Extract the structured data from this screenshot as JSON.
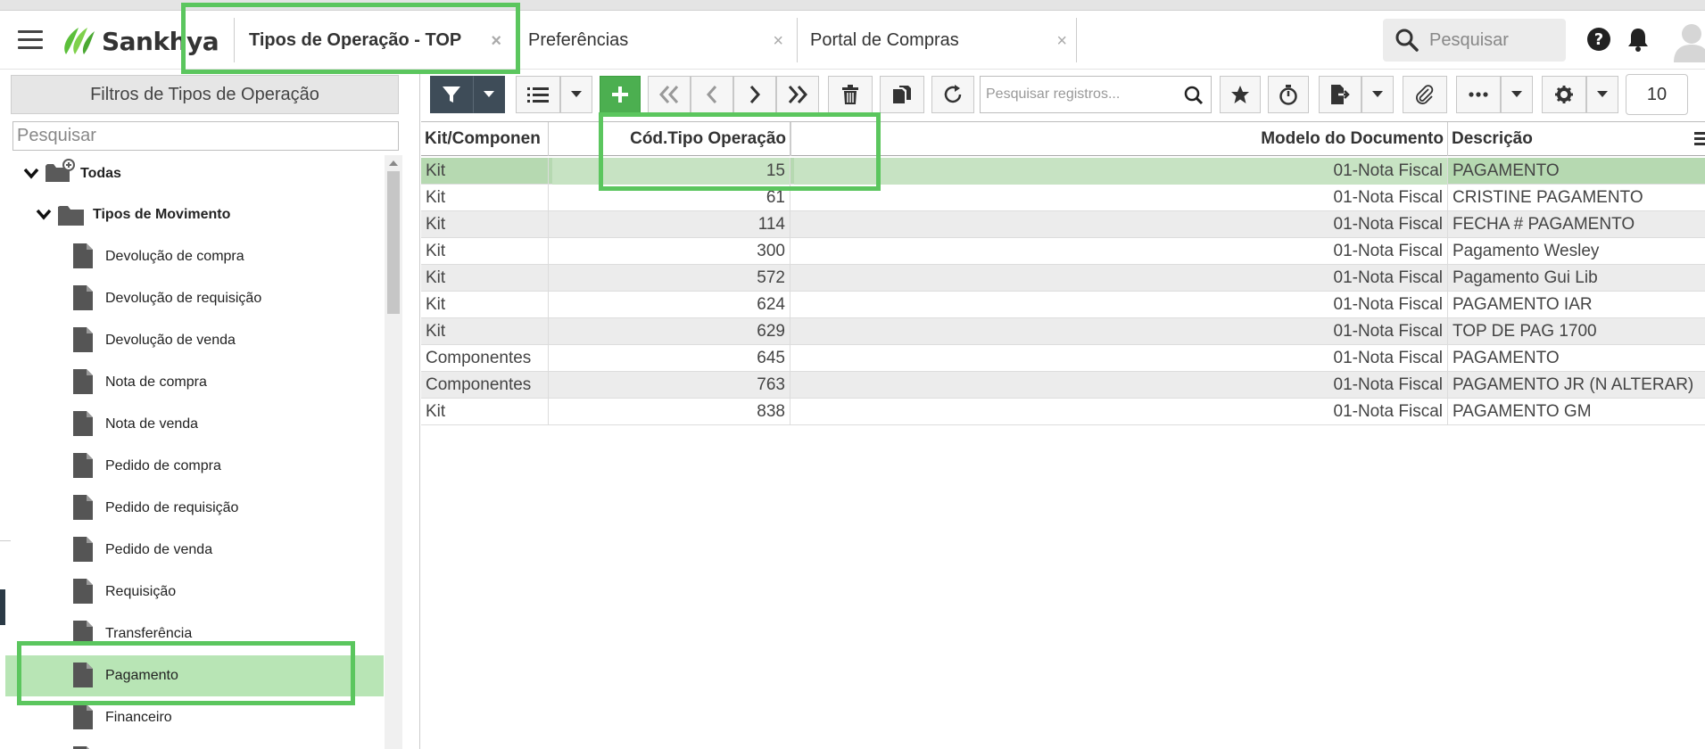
{
  "header": {
    "logo_text": "Sankhya",
    "tabs": [
      {
        "label": "Tipos de Operação - TOP",
        "active": true
      },
      {
        "label": "Preferências",
        "active": false
      },
      {
        "label": "Portal de Compras",
        "active": false
      }
    ],
    "close_glyph": "×",
    "search_placeholder": "Pesquisar",
    "icons": [
      "menu-icon",
      "search-icon",
      "help-icon",
      "bell-icon",
      "avatar-icon"
    ]
  },
  "sidebar": {
    "title": "Filtros de Tipos de Operação",
    "search_placeholder": "Pesquisar",
    "root": {
      "label": "Todas",
      "icon": "folder-plus-icon"
    },
    "group": {
      "label": "Tipos de Movimento",
      "icon": "folder-icon"
    },
    "items": [
      {
        "label": "Devolução de compra"
      },
      {
        "label": "Devolução de requisição"
      },
      {
        "label": "Devolução de venda"
      },
      {
        "label": "Nota de compra"
      },
      {
        "label": "Nota de venda"
      },
      {
        "label": "Pedido de compra"
      },
      {
        "label": "Pedido de requisição"
      },
      {
        "label": "Pedido de venda"
      },
      {
        "label": "Requisição"
      },
      {
        "label": "Transferência"
      },
      {
        "label": "Pagamento",
        "selected": true
      },
      {
        "label": "Financeiro"
      }
    ]
  },
  "toolbar": {
    "search_placeholder": "Pesquisar registros...",
    "page_size": "10",
    "buttons": [
      "filter-icon",
      "dropdown-icon",
      "list-icon",
      "dropdown-icon",
      "add-icon",
      "first-icon",
      "previous-icon",
      "next-icon",
      "last-icon",
      "delete-icon",
      "duplicate-icon",
      "refresh-icon",
      "star-icon",
      "timer-icon",
      "export-icon",
      "dropdown-icon",
      "attach-icon",
      "more-icon",
      "dropdown-icon",
      "gear-icon",
      "dropdown-icon"
    ]
  },
  "grid": {
    "columns": [
      "Kit/Componen",
      "Cód.Tipo Operação",
      "",
      "Modelo do Documento",
      "Descrição"
    ],
    "rows": [
      {
        "kit": "Kit",
        "codigo": "15",
        "modelo": "01-Nota Fiscal",
        "descricao": "PAGAMENTO",
        "selected": true
      },
      {
        "kit": "Kit",
        "codigo": "61",
        "modelo": "01-Nota Fiscal",
        "descricao": "CRISTINE PAGAMENTO"
      },
      {
        "kit": "Kit",
        "codigo": "114",
        "modelo": "01-Nota Fiscal",
        "descricao": "FECHA # PAGAMENTO"
      },
      {
        "kit": "Kit",
        "codigo": "300",
        "modelo": "01-Nota Fiscal",
        "descricao": "Pagamento Wesley"
      },
      {
        "kit": "Kit",
        "codigo": "572",
        "modelo": "01-Nota Fiscal",
        "descricao": "Pagamento Gui Lib"
      },
      {
        "kit": "Kit",
        "codigo": "624",
        "modelo": "01-Nota Fiscal",
        "descricao": "PAGAMENTO IAR"
      },
      {
        "kit": "Kit",
        "codigo": "629",
        "modelo": "01-Nota Fiscal",
        "descricao": "TOP DE PAG 1700"
      },
      {
        "kit": "Componentes",
        "codigo": "645",
        "modelo": "01-Nota Fiscal",
        "descricao": "PAGAMENTO"
      },
      {
        "kit": "Componentes",
        "codigo": "763",
        "modelo": "01-Nota Fiscal",
        "descricao": "PAGAMENTO JR (N ALTERAR)"
      },
      {
        "kit": "Kit",
        "codigo": "838",
        "modelo": "01-Nota Fiscal",
        "descricao": "PAGAMENTO GM"
      }
    ]
  },
  "colors": {
    "highlight": "#5bc65e",
    "selected_row": "#b6d9b1",
    "selected_tree": "#b8e5b5",
    "add_button": "#4caf50",
    "filter_button": "#3e4c58",
    "logo_green": "#5bbf3a"
  }
}
